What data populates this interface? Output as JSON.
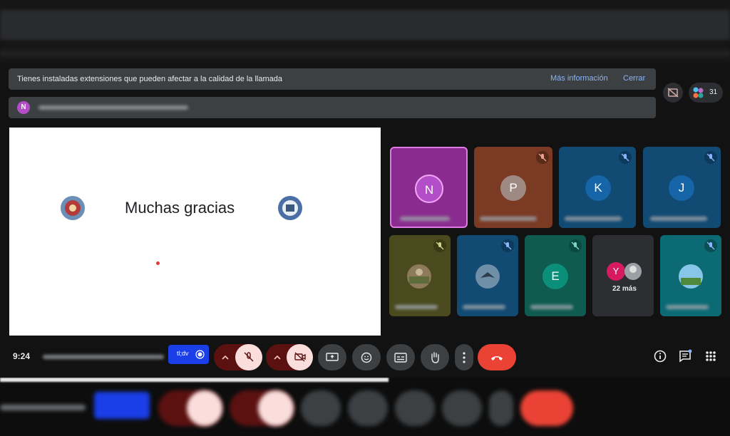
{
  "banner": {
    "message": "Tienes instaladas extensiones que pueden afectar a la calidad de la llamada",
    "more_info": "Más información",
    "close": "Cerrar"
  },
  "presenter": {
    "avatar_letter": "N"
  },
  "people_count": "31",
  "slide": {
    "title": "Muchas gracias"
  },
  "tiles": [
    {
      "letter": "N",
      "color": "#8a2c8f"
    },
    {
      "letter": "P",
      "color": "#7a3a24"
    },
    {
      "letter": "K",
      "color": "#114a73"
    },
    {
      "letter": "J",
      "color": "#114a73"
    },
    {
      "letter": "E",
      "color": "#0f5b50"
    },
    {
      "letter": "Y",
      "color": "#2d2e31"
    }
  ],
  "others": {
    "count": "22 más"
  },
  "controls": {
    "time": "9:24",
    "badge_text": "tl;dv"
  },
  "colors": {
    "accent": "#8ab4f8",
    "danger": "#ea4335",
    "badge": "#1a3ee8"
  },
  "icons": [
    "no-camera-icon",
    "people-icon",
    "mic-off-icon",
    "camera-off-icon",
    "present-icon",
    "emoji-icon",
    "captions-icon",
    "hand-icon",
    "more-icon",
    "end-call-icon",
    "info-icon",
    "chat-icon",
    "apps-icon"
  ]
}
